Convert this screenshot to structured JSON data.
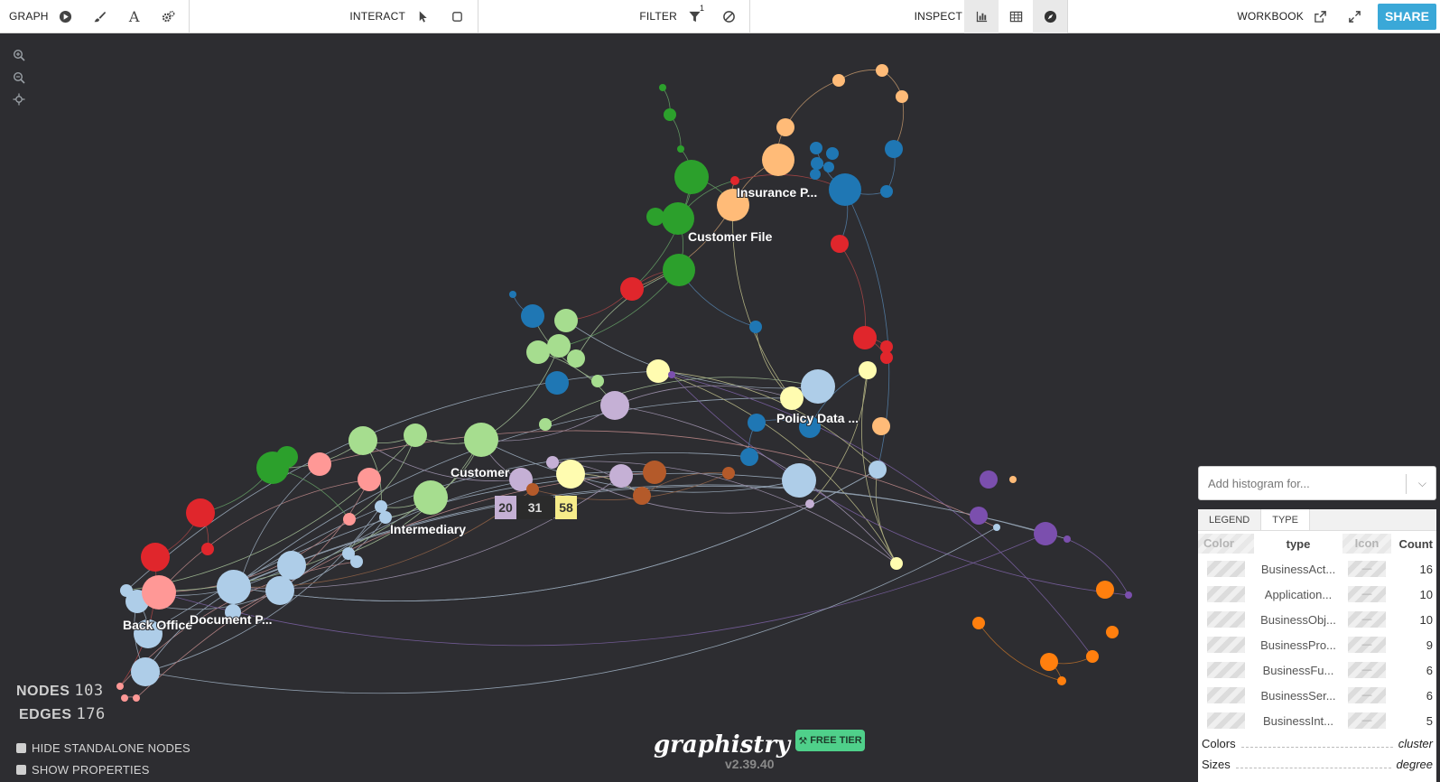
{
  "toolbar": {
    "graph_label": "GRAPH",
    "interact_label": "INTERACT",
    "filter_label": "FILTER",
    "filter_count": "1",
    "inspect_label": "INSPECT",
    "workbook_label": "WORKBOOK",
    "share_label": "SHARE"
  },
  "graph": {
    "labels": {
      "insurance": "Insurance P...",
      "customer_file": "Customer File",
      "policy_data": "Policy Data ...",
      "customer": "Customer",
      "intermediary": "Intermediary",
      "back_office": "Back Office",
      "document": "Document P..."
    },
    "selection_badges": [
      "20",
      "31",
      "58"
    ],
    "colors": {
      "background": "#2d2d31",
      "green": "#2ca02c",
      "light_green": "#98df8a",
      "orange_light": "#ffbb78",
      "blue": "#1f77b4",
      "light_blue": "#aec7e8",
      "red": "#d62728",
      "pink": "#ff9896",
      "lavender": "#c5b0d5",
      "yellow": "#ffff99",
      "brown": "#a55194",
      "orange": "#ff7f0e",
      "purple": "#9467bd"
    }
  },
  "stats": {
    "nodes_label": "NODES",
    "nodes_value": "103",
    "edges_label": "EDGES",
    "edges_value": "176",
    "hide_standalone": "HIDE STANDALONE NODES",
    "show_properties": "SHOW PROPERTIES"
  },
  "brand": {
    "logo": "graphistry",
    "version": "v2.39.40",
    "free_tier": "FREE TIER"
  },
  "histogram": {
    "placeholder": "Add histogram for..."
  },
  "legend": {
    "tabs": [
      "LEGEND",
      "TYPE"
    ],
    "headers": {
      "color": "Color",
      "type": "type",
      "icon": "Icon",
      "count": "Count"
    },
    "rows": [
      {
        "name": "BusinessAct...",
        "icon": "—",
        "count": "16"
      },
      {
        "name": "Application...",
        "icon": "—",
        "count": "10"
      },
      {
        "name": "BusinessObj...",
        "icon": "—",
        "count": "10"
      },
      {
        "name": "BusinessPro...",
        "icon": "—",
        "count": "9"
      },
      {
        "name": "BusinessFu...",
        "icon": "—",
        "count": "6"
      },
      {
        "name": "BusinessSer...",
        "icon": "—",
        "count": "6"
      },
      {
        "name": "BusinessInt...",
        "icon": "—",
        "count": "5"
      }
    ],
    "colors_key": "Colors",
    "colors_value": "cluster",
    "sizes_key": "Sizes",
    "sizes_value": "degree"
  }
}
